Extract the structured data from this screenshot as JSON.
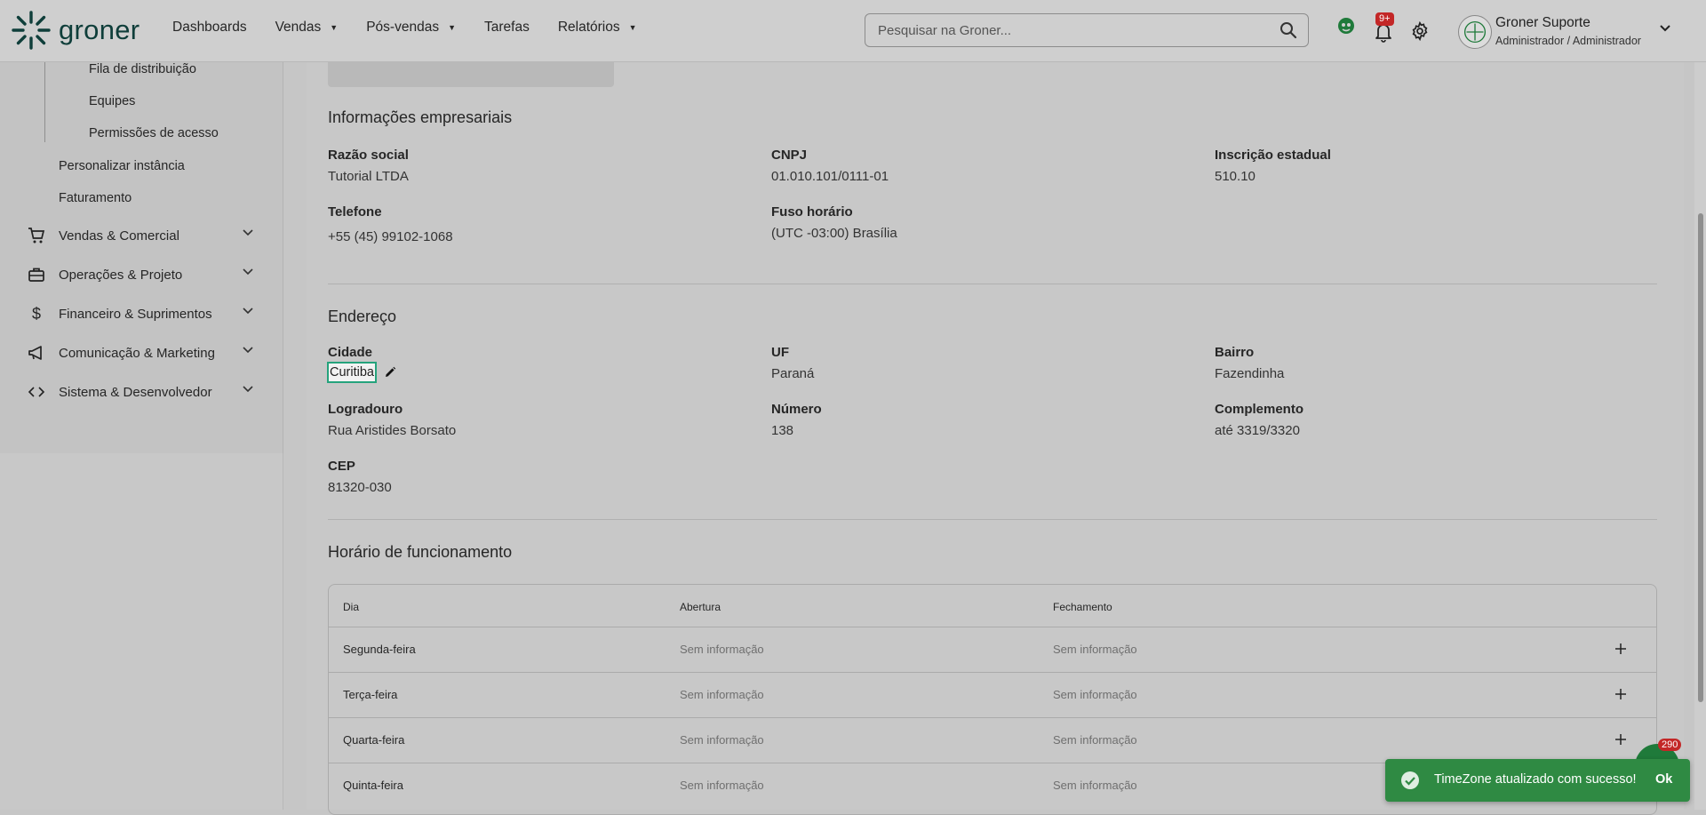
{
  "header": {
    "logo_text": "groner",
    "nav": [
      {
        "label": "Dashboards",
        "has_dropdown": false
      },
      {
        "label": "Vendas",
        "has_dropdown": true
      },
      {
        "label": "Pós-vendas",
        "has_dropdown": true
      },
      {
        "label": "Tarefas",
        "has_dropdown": false
      },
      {
        "label": "Relatórios",
        "has_dropdown": true
      }
    ],
    "search_placeholder": "Pesquisar na Groner...",
    "notifications_badge": "9+",
    "user_name": "Groner Suporte",
    "user_role": "Administrador / Administrador"
  },
  "sidebar": {
    "sub_items": [
      "Fila de distribuição",
      "Equipes",
      "Permissões de acesso"
    ],
    "items": [
      "Personalizar instância",
      "Faturamento"
    ],
    "groups": [
      {
        "label": "Vendas & Comercial",
        "icon": "cart-icon"
      },
      {
        "label": "Operações & Projeto",
        "icon": "briefcase-icon"
      },
      {
        "label": "Financeiro & Suprimentos",
        "icon": "dollar-icon"
      },
      {
        "label": "Comunicação & Marketing",
        "icon": "megaphone-icon"
      },
      {
        "label": "Sistema & Desenvolvedor",
        "icon": "code-icon"
      }
    ]
  },
  "business_info": {
    "title": "Informações empresariais",
    "fields": [
      {
        "label": "Razão social",
        "value": "Tutorial LTDA"
      },
      {
        "label": "CNPJ",
        "value": "01.010.101/0111-01"
      },
      {
        "label": "Inscrição estadual",
        "value": "510.10"
      },
      {
        "label": "Telefone",
        "value": "+55 (45) 99102-1068"
      },
      {
        "label": "Fuso horário",
        "value": "(UTC -03:00) Brasília"
      }
    ]
  },
  "address": {
    "title": "Endereço",
    "city_label": "Cidade",
    "city_value": "Curitiba",
    "fields": [
      {
        "label": "UF",
        "value": "Paraná"
      },
      {
        "label": "Bairro",
        "value": "Fazendinha"
      },
      {
        "label": "Logradouro",
        "value": "Rua Aristides Borsato"
      },
      {
        "label": "Número",
        "value": "138"
      },
      {
        "label": "Complemento",
        "value": "até 3319/3320"
      },
      {
        "label": "CEP",
        "value": "81320-030"
      }
    ]
  },
  "hours": {
    "title": "Horário de funcionamento",
    "columns": [
      "Dia",
      "Abertura",
      "Fechamento"
    ],
    "rows": [
      {
        "day": "Segunda-feira",
        "open": "Sem informação",
        "close": "Sem informação"
      },
      {
        "day": "Terça-feira",
        "open": "Sem informação",
        "close": "Sem informação"
      },
      {
        "day": "Quarta-feira",
        "open": "Sem informação",
        "close": "Sem informação"
      },
      {
        "day": "Quinta-feira",
        "open": "Sem informação",
        "close": "Sem informação"
      }
    ]
  },
  "chat": {
    "badge": "290"
  },
  "toast": {
    "message": "TimeZone atualizado com sucesso!",
    "action": "Ok"
  },
  "colors": {
    "brand": "#0f3e3a",
    "focus_border": "#25a37c",
    "toast_bg": "#2f8a43",
    "badge_red": "#c32727"
  }
}
